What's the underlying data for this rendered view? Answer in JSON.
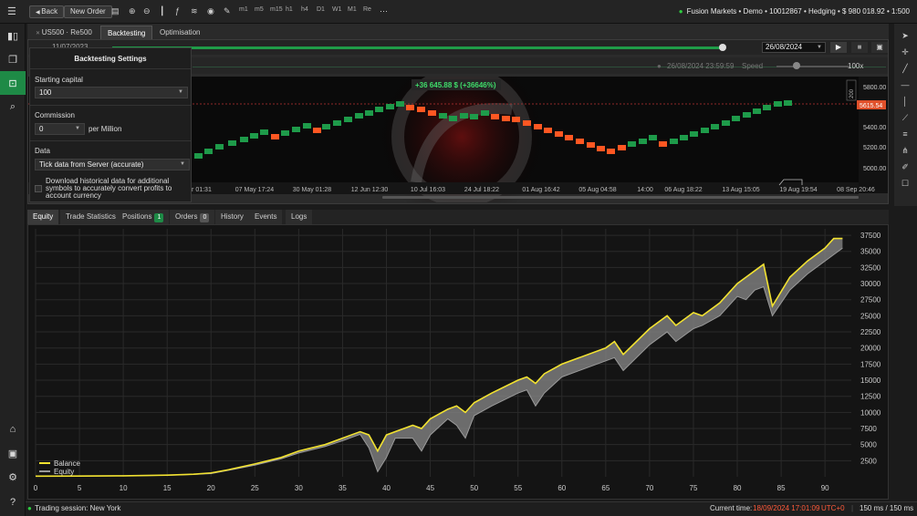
{
  "toolbar": {
    "back_label": "Back",
    "new_order_label": "New Order",
    "timeframes": [
      "m1",
      "m5",
      "m15",
      "h1",
      "h4",
      "D1",
      "W1",
      "M1",
      "Re"
    ]
  },
  "account": {
    "text": "Fusion Markets • Demo • 10012867 • Hedging • $ 980 018.92 • 1:500"
  },
  "symbol_tabs": {
    "symbol": "US500",
    "renko": "Re500",
    "backtesting": "Backtesting",
    "optimisation": "Optimisation"
  },
  "backtest": {
    "start_date": "11/07/2023",
    "end_date": "26/08/2024",
    "playback_time": "26/08/2024 23:59:59",
    "speed_label": "Speed",
    "speed_value": "100x"
  },
  "settings": {
    "title": "Backtesting Settings",
    "starting_capital_label": "Starting capital",
    "starting_capital_value": "100",
    "commission_label": "Commission",
    "commission_value": "0",
    "commission_unit": "per Million",
    "data_label": "Data",
    "data_value": "Tick data from Server (accurate)",
    "download_label": "Download historical data for additional symbols to accurately convert profits to account currency"
  },
  "price_chart": {
    "profit_label": "+36 645.88 $ (+36646%)",
    "current_price": "5615.54",
    "y_ticks": [
      "5800.00",
      "5600.00",
      "5400.00",
      "5200.00",
      "5000.00"
    ],
    "scale_label": "200",
    "x_ticks": [
      "or 01:31",
      "07 May 17:24",
      "30 May 01:28",
      "12 Jun 12:30",
      "10 Jul 16:03",
      "24 Jul 18:22",
      "01 Aug 16:42",
      "05 Aug 04:58",
      "14:00",
      "06 Aug 18:22",
      "13 Aug 15:05",
      "19 Aug 19:54",
      "08 Sep 20:46"
    ],
    "colors": {
      "up": "#1e9b4a",
      "down": "#ff5722"
    },
    "bricks": [
      {
        "x": 216,
        "y": 171,
        "d": "up"
      },
      {
        "x": 227,
        "y": 166,
        "d": "up"
      },
      {
        "x": 239,
        "y": 161,
        "d": "up"
      },
      {
        "x": 253,
        "y": 157,
        "d": "up"
      },
      {
        "x": 266,
        "y": 153,
        "d": "up"
      },
      {
        "x": 277,
        "y": 149,
        "d": "up"
      },
      {
        "x": 288,
        "y": 145,
        "d": "up"
      },
      {
        "x": 300,
        "y": 150,
        "d": "down"
      },
      {
        "x": 311,
        "y": 146,
        "d": "up"
      },
      {
        "x": 323,
        "y": 142,
        "d": "up"
      },
      {
        "x": 335,
        "y": 138,
        "d": "up"
      },
      {
        "x": 346,
        "y": 143,
        "d": "down"
      },
      {
        "x": 356,
        "y": 139,
        "d": "up"
      },
      {
        "x": 368,
        "y": 135,
        "d": "up"
      },
      {
        "x": 380,
        "y": 131,
        "d": "up"
      },
      {
        "x": 392,
        "y": 127,
        "d": "up"
      },
      {
        "x": 403,
        "y": 124,
        "d": "up"
      },
      {
        "x": 414,
        "y": 120,
        "d": "up"
      },
      {
        "x": 426,
        "y": 117,
        "d": "up"
      },
      {
        "x": 437,
        "y": 114,
        "d": "up"
      },
      {
        "x": 448,
        "y": 118,
        "d": "down"
      },
      {
        "x": 460,
        "y": 120,
        "d": "down"
      },
      {
        "x": 472,
        "y": 124,
        "d": "down"
      },
      {
        "x": 484,
        "y": 127,
        "d": "up"
      },
      {
        "x": 495,
        "y": 130,
        "d": "up"
      },
      {
        "x": 507,
        "y": 127,
        "d": "up"
      },
      {
        "x": 518,
        "y": 128,
        "d": "up"
      },
      {
        "x": 530,
        "y": 124,
        "d": "up"
      },
      {
        "x": 541,
        "y": 128,
        "d": "down"
      },
      {
        "x": 553,
        "y": 130,
        "d": "down"
      },
      {
        "x": 564,
        "y": 131,
        "d": "down"
      },
      {
        "x": 576,
        "y": 135,
        "d": "down"
      },
      {
        "x": 588,
        "y": 139,
        "d": "down"
      },
      {
        "x": 599,
        "y": 143,
        "d": "down"
      },
      {
        "x": 611,
        "y": 147,
        "d": "down"
      },
      {
        "x": 622,
        "y": 151,
        "d": "down"
      },
      {
        "x": 634,
        "y": 155,
        "d": "down"
      },
      {
        "x": 646,
        "y": 159,
        "d": "down"
      },
      {
        "x": 657,
        "y": 163,
        "d": "down"
      },
      {
        "x": 668,
        "y": 166,
        "d": "down"
      },
      {
        "x": 680,
        "y": 162,
        "d": "down"
      },
      {
        "x": 691,
        "y": 158,
        "d": "up"
      },
      {
        "x": 703,
        "y": 155,
        "d": "up"
      },
      {
        "x": 714,
        "y": 151,
        "d": "up"
      },
      {
        "x": 725,
        "y": 158,
        "d": "down"
      },
      {
        "x": 737,
        "y": 155,
        "d": "up"
      },
      {
        "x": 748,
        "y": 151,
        "d": "up"
      },
      {
        "x": 759,
        "y": 147,
        "d": "up"
      },
      {
        "x": 771,
        "y": 143,
        "d": "up"
      },
      {
        "x": 782,
        "y": 139,
        "d": "up"
      },
      {
        "x": 794,
        "y": 135,
        "d": "up"
      },
      {
        "x": 805,
        "y": 130,
        "d": "up"
      },
      {
        "x": 817,
        "y": 126,
        "d": "up"
      },
      {
        "x": 828,
        "y": 122,
        "d": "up"
      },
      {
        "x": 839,
        "y": 118,
        "d": "up"
      },
      {
        "x": 851,
        "y": 114,
        "d": "up"
      },
      {
        "x": 862,
        "y": 113,
        "d": "up"
      }
    ]
  },
  "bottom_tabs": {
    "equity": "Equity",
    "trade_statistics": "Trade Statistics",
    "positions": "Positions",
    "positions_count": "1",
    "orders": "Orders",
    "orders_count": "0",
    "history": "History",
    "events": "Events",
    "logs": "Logs"
  },
  "chart_data": {
    "type": "line",
    "xlim": [
      0,
      93
    ],
    "ylim": [
      0,
      38500
    ],
    "x_ticks": [
      0,
      5,
      10,
      15,
      20,
      25,
      30,
      35,
      40,
      45,
      50,
      55,
      60,
      65,
      70,
      75,
      80,
      85,
      90
    ],
    "y_ticks": [
      2500,
      5000,
      7500,
      10000,
      12500,
      15000,
      17500,
      20000,
      22500,
      25000,
      27500,
      30000,
      32500,
      35000,
      37500
    ],
    "grid": true,
    "legend": "bottom-left",
    "colors": {
      "balance": "#f2e230",
      "equity": "#9a9a9a",
      "band": "#8a8a8a"
    },
    "series": [
      {
        "name": "Balance",
        "x": [
          0,
          5,
          10,
          15,
          18,
          20,
          22,
          25,
          28,
          30,
          33,
          35,
          37,
          38,
          39,
          40,
          41,
          43,
          44,
          45,
          47,
          48,
          49,
          50,
          52,
          55,
          56,
          57,
          58,
          60,
          62,
          65,
          66,
          67,
          70,
          72,
          73,
          75,
          76,
          78,
          80,
          81,
          82,
          83,
          84,
          86,
          88,
          90,
          91,
          92
        ],
        "y": [
          100,
          120,
          150,
          250,
          400,
          600,
          1100,
          2000,
          3000,
          4000,
          5000,
          6000,
          7000,
          6500,
          4000,
          6500,
          7000,
          8000,
          7500,
          9000,
          10500,
          11000,
          10000,
          11500,
          13000,
          15000,
          15500,
          14500,
          16000,
          17500,
          18500,
          20000,
          21000,
          19000,
          23000,
          25000,
          23500,
          25500,
          25000,
          27000,
          30000,
          31000,
          32000,
          33000,
          26500,
          31000,
          33500,
          35500,
          37000,
          37000
        ]
      },
      {
        "name": "Equity",
        "x": [
          0,
          5,
          10,
          15,
          18,
          20,
          22,
          25,
          28,
          30,
          33,
          35,
          37,
          38,
          39,
          40,
          41,
          43,
          44,
          45,
          47,
          48,
          49,
          50,
          52,
          55,
          56,
          57,
          58,
          60,
          62,
          65,
          66,
          67,
          70,
          72,
          73,
          75,
          76,
          78,
          80,
          81,
          82,
          83,
          84,
          86,
          88,
          90,
          91,
          92
        ],
        "y": [
          100,
          110,
          140,
          230,
          380,
          500,
          1000,
          1800,
          2800,
          3700,
          4700,
          5600,
          6600,
          4500,
          800,
          3000,
          6000,
          6000,
          4000,
          6500,
          9000,
          8000,
          6000,
          9500,
          11000,
          13000,
          13500,
          11000,
          13000,
          15500,
          16500,
          18000,
          18500,
          16500,
          20500,
          22500,
          21000,
          23000,
          23500,
          25000,
          28000,
          27500,
          29000,
          29500,
          25000,
          29000,
          31500,
          33500,
          34500,
          35500
        ]
      }
    ]
  },
  "status": {
    "session_label": "Trading session: New York",
    "current_time_label": "Current time:",
    "current_time_value": "18/09/2024 17:01:09",
    "timezone": "UTC+0",
    "latency": "150 ms / 150 ms"
  }
}
